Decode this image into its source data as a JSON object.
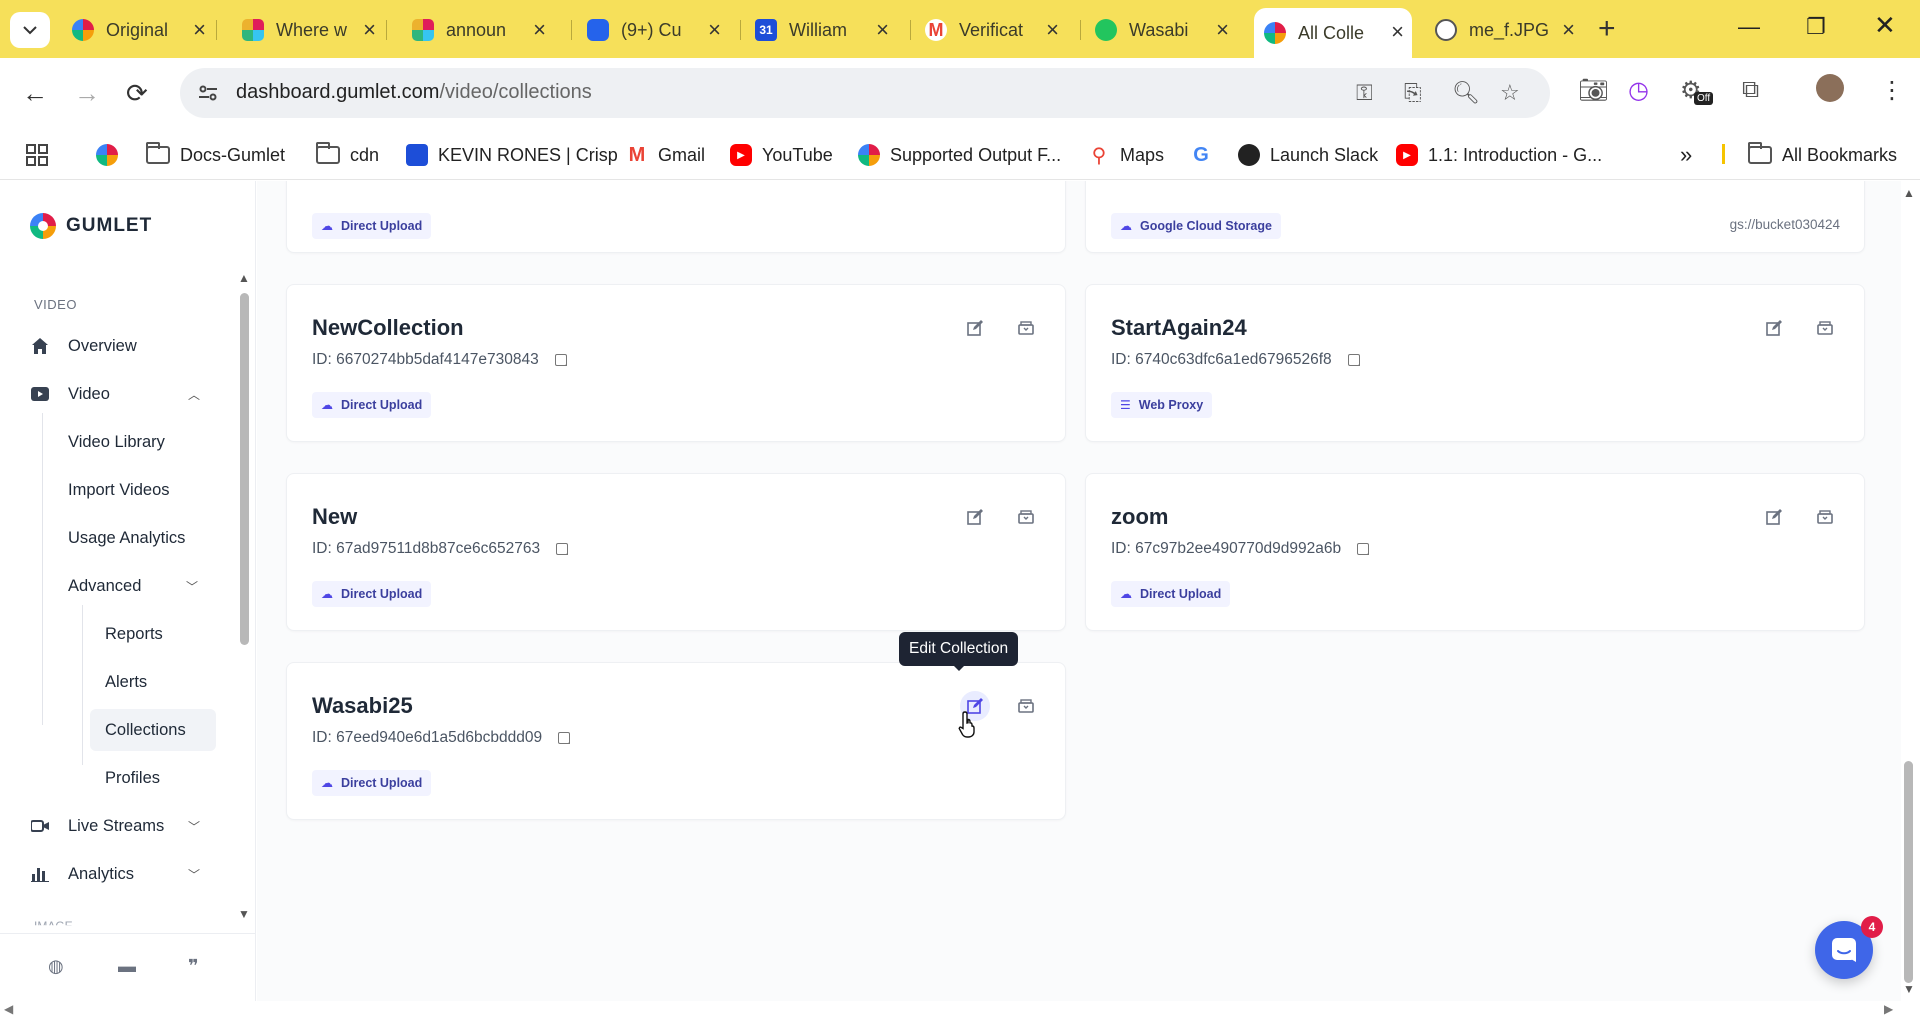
{
  "browser": {
    "tabs": [
      {
        "label": "Original",
        "icon": "gumlet-favicon",
        "color": "#e11d48"
      },
      {
        "label": "Where w",
        "icon": "slack-favicon",
        "color": "#4a154b"
      },
      {
        "label": "announ",
        "icon": "slack-favicon",
        "color": "#4a154b"
      },
      {
        "label": "(9+) Cu",
        "icon": "database-favicon",
        "color": "#2563eb"
      },
      {
        "label": "William",
        "icon": "calendar-favicon",
        "color": "#1d4ed8"
      },
      {
        "label": "Verificat",
        "icon": "gmail-favicon",
        "color": "#ea4335"
      },
      {
        "label": "Wasabi",
        "icon": "wasabi-favicon",
        "color": "#22c55e"
      },
      {
        "label": "All Colle",
        "icon": "gumlet-favicon",
        "color": "#e11d48",
        "active": true
      },
      {
        "label": "me_f.JPG",
        "icon": "globe-favicon",
        "color": "#555555"
      }
    ],
    "url_domain": "dashboard.gumlet.com",
    "url_path": "/video/collections",
    "extension_badge": "Off",
    "bookmarks": [
      {
        "label": "Docs-Gumlet",
        "icon": "folder-icon"
      },
      {
        "label": "cdn",
        "icon": "folder-icon"
      },
      {
        "label": "KEVIN RONES | Crisp",
        "icon": "crisp-icon"
      },
      {
        "label": "Gmail",
        "icon": "gmail-icon"
      },
      {
        "label": "YouTube",
        "icon": "youtube-icon"
      },
      {
        "label": "Supported Output F...",
        "icon": "gumlet-icon"
      },
      {
        "label": "Maps",
        "icon": "maps-icon"
      },
      {
        "label": "",
        "icon": "google-icon"
      },
      {
        "label": "Launch Slack",
        "icon": "github-icon"
      },
      {
        "label": "1.1: Introduction - G...",
        "icon": "youtube-icon"
      }
    ],
    "all_bookmarks": "All Bookmarks"
  },
  "sidebar": {
    "logo": "GUMLET",
    "section": "VIDEO",
    "items": {
      "overview": "Overview",
      "video": "Video",
      "video_library": "Video Library",
      "import_videos": "Import Videos",
      "usage_analytics": "Usage Analytics",
      "advanced": "Advanced",
      "reports": "Reports",
      "alerts": "Alerts",
      "collections": "Collections",
      "profiles": "Profiles",
      "live_streams": "Live Streams",
      "analytics": "Analytics"
    },
    "next_section_fade": "IMAGE"
  },
  "collections": [
    {
      "title": "",
      "id": "",
      "source": "Direct Upload",
      "source_icon": "cloud-upload-icon"
    },
    {
      "title": "",
      "id": "",
      "source": "Google Cloud Storage",
      "source_icon": "cloud-upload-icon",
      "path": "gs://bucket030424"
    },
    {
      "title": "NewCollection",
      "id": "ID: 6670274bb5daf4147e730843",
      "source": "Direct Upload",
      "source_icon": "cloud-upload-icon"
    },
    {
      "title": "StartAgain24",
      "id": "ID: 6740c63dfc6a1ed6796526f8",
      "source": "Web Proxy",
      "source_icon": "list-icon"
    },
    {
      "title": "New",
      "id": "ID: 67ad97511d8b87ce6c652763",
      "source": "Direct Upload",
      "source_icon": "cloud-upload-icon"
    },
    {
      "title": "zoom",
      "id": "ID: 67c97b2ee490770d9d992a6b",
      "source": "Direct Upload",
      "source_icon": "cloud-upload-icon"
    },
    {
      "title": "Wasabi25",
      "id": "ID: 67eed940e6d1a5d6bcbddd09",
      "source": "Direct Upload",
      "source_icon": "cloud-upload-icon"
    }
  ],
  "tooltip": "Edit Collection",
  "chat": {
    "badge_count": "4"
  },
  "colors": {
    "accent": "#4f46e5",
    "chrome_yellow": "#f6e05a",
    "chat": "#3f66e8"
  }
}
